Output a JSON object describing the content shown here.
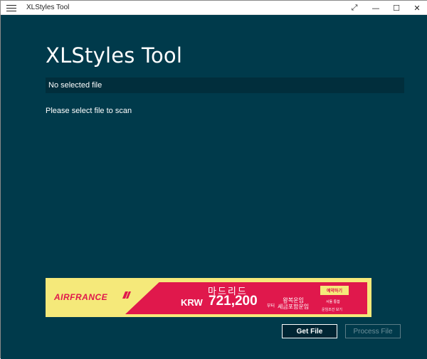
{
  "window": {
    "title": "XLStyles Tool",
    "controls": {
      "fullscreen": "⤢",
      "minimize": "—",
      "maximize": "☐",
      "close": "✕"
    }
  },
  "main": {
    "app_title": "XLStyles Tool",
    "file_field_text": "No selected file",
    "status_text": "Please select file to scan"
  },
  "ad": {
    "brand": "AIRFRANCE",
    "headline": "마드리드",
    "price_prefix": "KRW",
    "price": "721,200",
    "price_suffix": "부터",
    "route_line1": "왕복운임",
    "route_line2": "세금포함운임",
    "cta": "예약하기",
    "note1": "서둘 통합",
    "note2": "운임조건 보기"
  },
  "buttons": {
    "get_file": "Get File",
    "process_file": "Process File"
  },
  "colors": {
    "background": "#003a4b",
    "field_background": "#012e3c",
    "ad_yellow": "#f5e97a",
    "ad_red": "#e0184c"
  }
}
